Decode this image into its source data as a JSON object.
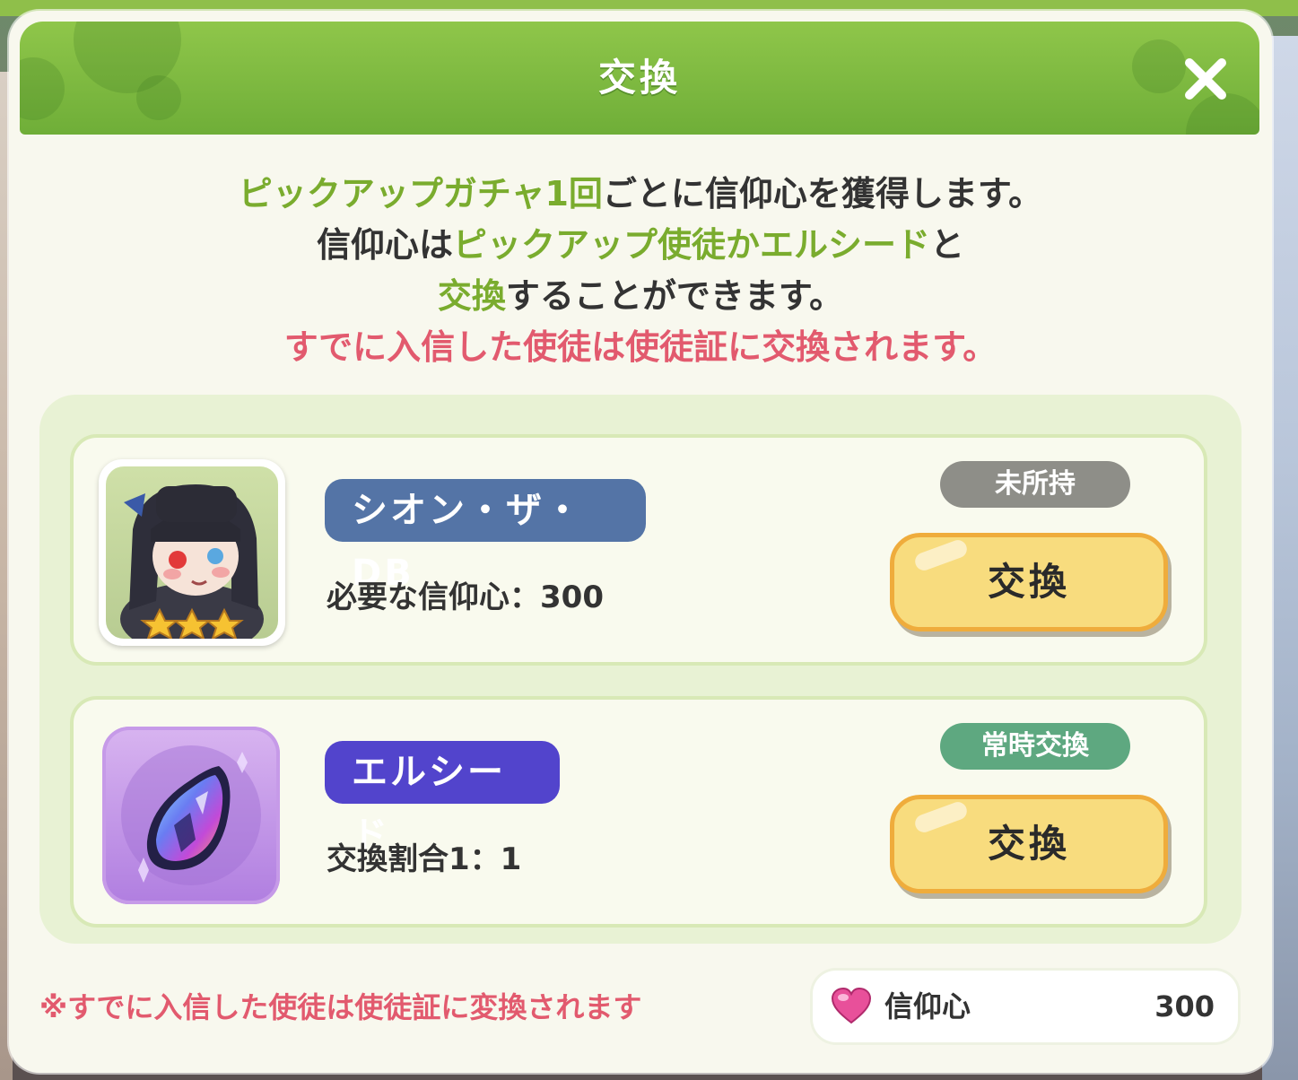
{
  "dialog": {
    "title": "交換",
    "close_icon": "close-icon"
  },
  "info": {
    "line1_green": "ピックアップガチャ1回",
    "line1_black": "ごとに信仰心を獲得します。",
    "line2_black_a": "信仰心は",
    "line2_green": "ピックアップ使徒かエルシード",
    "line2_black_b": "と",
    "line3_green": "交換",
    "line3_black": "することができます。",
    "line4_red": "すでに入信した使徒は使徒証に交換されます。"
  },
  "items": [
    {
      "name": "シオン・ザ・DB",
      "requirement": "必要な信仰心：300",
      "status": "未所持",
      "button": "交換",
      "stars": 3,
      "icon": "character-portrait"
    },
    {
      "name": "エルシード",
      "requirement": "交換割合1：1",
      "status": "常時交換",
      "button": "交換",
      "icon": "crystal-icon"
    }
  ],
  "footer": {
    "note": "※すでに入信した使徒は使徒証に変換されます",
    "currency_label": "信仰心",
    "currency_value": "300",
    "currency_icon": "heart-icon"
  },
  "colors": {
    "header_green": "#7bb83e",
    "accent_green": "#7aac2e",
    "warning_red": "#e25a6e",
    "name_blue": "#5474a6",
    "name_purple": "#5244cc",
    "button_yellow": "#f8dc7e",
    "button_border": "#efac3c",
    "status_gray": "#8e8e88",
    "status_green": "#5ea880"
  }
}
